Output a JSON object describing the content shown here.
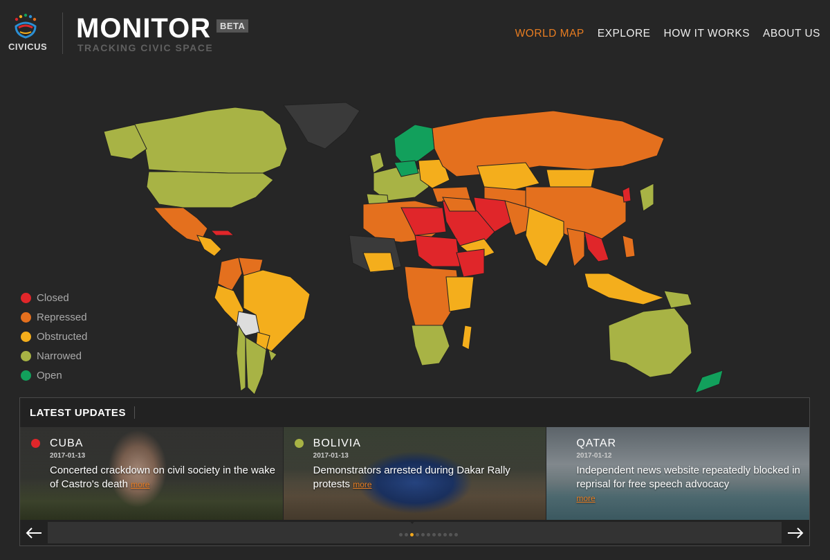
{
  "brand": {
    "org": "CIVICUS",
    "title": "MONITOR",
    "badge": "BETA",
    "tagline": "TRACKING CIVIC SPACE"
  },
  "nav": {
    "items": [
      {
        "label": "WORLD MAP",
        "active": true
      },
      {
        "label": "EXPLORE",
        "active": false
      },
      {
        "label": "HOW IT WORKS",
        "active": false
      },
      {
        "label": "ABOUT US",
        "active": false
      }
    ]
  },
  "colors": {
    "closed": "#e0262a",
    "repressed": "#e4701e",
    "obstructed": "#f4ae1c",
    "narrowed": "#a8b345",
    "open": "#12a05c",
    "accent": "#e87d21",
    "no_data": "#3a3a3a"
  },
  "legend": {
    "items": [
      {
        "label": "Closed",
        "color": "#e0262a"
      },
      {
        "label": "Repressed",
        "color": "#e4701e"
      },
      {
        "label": "Obstructed",
        "color": "#f4ae1c"
      },
      {
        "label": "Narrowed",
        "color": "#a8b345"
      },
      {
        "label": "Open",
        "color": "#12a05c"
      }
    ]
  },
  "updates": {
    "title": "LATEST UPDATES",
    "more_label": "more",
    "cards": [
      {
        "country": "CUBA",
        "date": "2017-01-13",
        "headline": "Concerted crackdown on civil society in the wake of Castro's death",
        "status_color": "#e0262a",
        "image": "portrait-photo"
      },
      {
        "country": "BOLIVIA",
        "date": "2017-01-13",
        "headline": "Demonstrators arrested during Dakar Rally protests",
        "status_color": "#a8b345",
        "image": "rally-car-photo"
      },
      {
        "country": "QATAR",
        "date": "2017-01-12",
        "headline": "Independent news website repeatedly blocked in reprisal for free speech advocacy",
        "status_color": "",
        "image": "city-skyline-photo"
      }
    ],
    "pager": {
      "prev_icon": "arrow-left-icon",
      "next_icon": "arrow-right-icon",
      "total_dots": 11,
      "active_dot": 2
    }
  }
}
